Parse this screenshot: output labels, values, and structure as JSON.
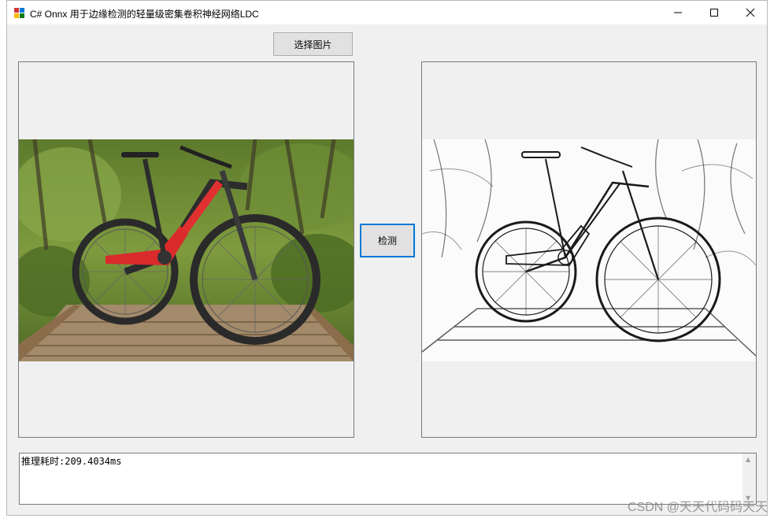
{
  "window": {
    "title": "C# Onnx 用于边缘检测的轻量级密集卷积神经网络LDC"
  },
  "toolbar": {
    "select_image_label": "选择图片",
    "detect_label": "检测"
  },
  "output": {
    "text": "推理耗时:209.4034ms"
  },
  "watermark": {
    "text": "CSDN @天天代码码天天"
  },
  "icons": {
    "minimize": "minimize-icon",
    "maximize": "maximize-icon",
    "close": "close-icon"
  }
}
